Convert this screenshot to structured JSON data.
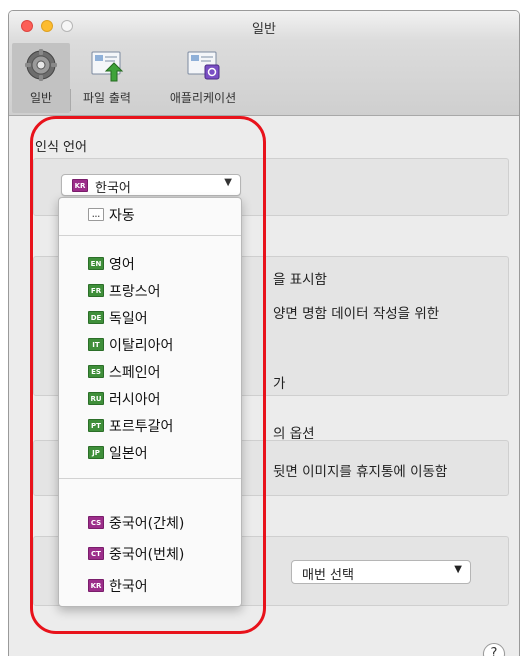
{
  "window": {
    "title": "일반"
  },
  "toolbar": {
    "items": [
      {
        "label": "일반",
        "icon": "gear-icon"
      },
      {
        "label": "파일 출력",
        "icon": "file-output-icon"
      },
      {
        "label": "애플리케이션",
        "icon": "application-icon"
      }
    ]
  },
  "recognition": {
    "label": "인식 언어",
    "selected": {
      "code": "KR",
      "name": "한국어"
    }
  },
  "language_menu": {
    "items": [
      {
        "code": "...",
        "name": "자동",
        "color": "auto"
      },
      {
        "code": "EN",
        "name": "영어",
        "color": "green"
      },
      {
        "code": "FR",
        "name": "프랑스어",
        "color": "green"
      },
      {
        "code": "DE",
        "name": "독일어",
        "color": "green"
      },
      {
        "code": "IT",
        "name": "이탈리아어",
        "color": "green"
      },
      {
        "code": "ES",
        "name": "스페인어",
        "color": "green"
      },
      {
        "code": "RU",
        "name": "러시아어",
        "color": "green"
      },
      {
        "code": "PT",
        "name": "포르투갈어",
        "color": "green"
      },
      {
        "code": "JP",
        "name": "일본어",
        "color": "green"
      },
      {
        "code": "CS",
        "name": "중국어(간체)",
        "color": "purple"
      },
      {
        "code": "CT",
        "name": "중국어(번체)",
        "color": "purple"
      },
      {
        "code": "KR",
        "name": "한국어",
        "color": "purple"
      }
    ]
  },
  "background": {
    "text1": "을 표시함",
    "text2": "양면 명함 데이터 작성을 위한",
    "text3": "가",
    "text4": "의 옵션",
    "text5": "뒷면 이미지를 휴지통에 이동함",
    "mode_select": "매번 선택"
  },
  "help": {
    "symbol": "?"
  },
  "colors": {
    "highlight": "#e8121b",
    "flag_green": "#3f8f3a",
    "flag_purple": "#9c2d8a"
  }
}
